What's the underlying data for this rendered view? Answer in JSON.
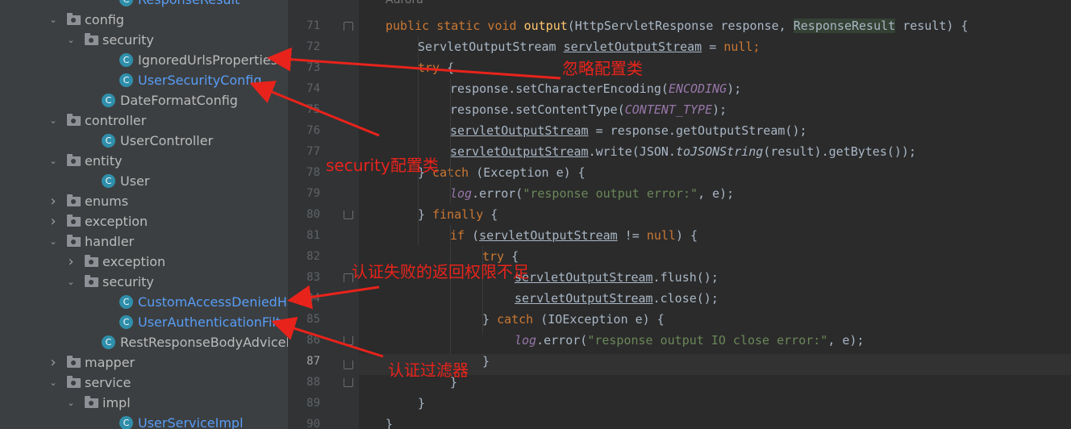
{
  "tree": {
    "items": [
      {
        "label": "ResponseResult",
        "kind": "class",
        "blue": true
      },
      {
        "label": "config",
        "kind": "folder",
        "expanded": true
      },
      {
        "label": "security",
        "kind": "folder",
        "expanded": true
      },
      {
        "label": "IgnoredUrlsProperties",
        "kind": "class",
        "blue": false
      },
      {
        "label": "UserSecurityConfig",
        "kind": "class",
        "blue": true
      },
      {
        "label": "DateFormatConfig",
        "kind": "class",
        "blue": false
      },
      {
        "label": "controller",
        "kind": "folder",
        "expanded": true
      },
      {
        "label": "UserController",
        "kind": "class",
        "blue": false
      },
      {
        "label": "entity",
        "kind": "folder",
        "expanded": true
      },
      {
        "label": "User",
        "kind": "class",
        "blue": false
      },
      {
        "label": "enums",
        "kind": "folder",
        "expanded": false
      },
      {
        "label": "exception",
        "kind": "folder",
        "expanded": false
      },
      {
        "label": "handler",
        "kind": "folder",
        "expanded": true
      },
      {
        "label": "exception",
        "kind": "folder",
        "expanded": false
      },
      {
        "label": "security",
        "kind": "folder",
        "expanded": true
      },
      {
        "label": "CustomAccessDeniedHandl",
        "kind": "class",
        "blue": true
      },
      {
        "label": "UserAuthenticationFilter",
        "kind": "class",
        "blue": true
      },
      {
        "label": "RestResponseBodyAdviceHand",
        "kind": "class",
        "blue": false
      },
      {
        "label": "mapper",
        "kind": "folder",
        "expanded": false
      },
      {
        "label": "service",
        "kind": "folder",
        "expanded": true
      },
      {
        "label": "impl",
        "kind": "folder",
        "expanded": true
      },
      {
        "label": "UserServiceImpl",
        "kind": "class",
        "blue": true
      }
    ]
  },
  "editor": {
    "author_hint": "Aurora",
    "line_numbers": [
      "71",
      "72",
      "73",
      "74",
      "75",
      "76",
      "77",
      "78",
      "79",
      "80",
      "81",
      "82",
      "83",
      "84",
      "85",
      "86",
      "87",
      "88",
      "89",
      "90"
    ],
    "current_line": "87",
    "code": {
      "l71": {
        "kw1": "public static void ",
        "fn": "output",
        "p1": "(HttpServletResponse response, ",
        "hl": "ResponseResult",
        "p2": " result) {"
      },
      "l72": {
        "a": "ServletOutputStream ",
        "b": "servletOutputStream",
        "c": " = ",
        "d": "null",
        "e": ";"
      },
      "l73": {
        "a": "try",
        "b": " {"
      },
      "l74": {
        "a": "response.setCharacterEncoding(",
        "b": "ENCODING",
        "c": ");"
      },
      "l75": {
        "a": "response.setContentType(",
        "b": "CONTENT_TYPE",
        "c": ");"
      },
      "l76": {
        "a": "servletOutputStream",
        "b": " = response.getOutputStream();"
      },
      "l77": {
        "a": "servletOutputStream",
        "b": ".write(JSON.",
        "c": "toJSONString",
        "d": "(result).getBytes());"
      },
      "l78": {
        "a": "} ",
        "b": "catch",
        "c": " (Exception e) {"
      },
      "l79": {
        "a": "log",
        "b": ".error(",
        "c": "\"response output error:\"",
        "d": ", e);"
      },
      "l80": {
        "a": "} ",
        "b": "finally",
        "c": " {"
      },
      "l81": {
        "a": "if",
        "b": " (",
        "c": "servletOutputStream",
        "d": " != ",
        "e": "null",
        "f": ") {"
      },
      "l82": {
        "a": "try",
        "b": " {"
      },
      "l83": {
        "a": "servletOutputStream",
        "b": ".flush();"
      },
      "l84": {
        "a": "servletOutputStream",
        "b": ".close();"
      },
      "l85": {
        "a": "} ",
        "b": "catch",
        "c": " (IOException e) {"
      },
      "l86": {
        "a": "log",
        "b": ".error(",
        "c": "\"response output IO close error:\"",
        "d": ", e);"
      },
      "l87": {
        "a": "}"
      },
      "l88": {
        "a": "}"
      },
      "l89": {
        "a": "}"
      },
      "l90": {
        "a": "}"
      }
    }
  },
  "annotations": {
    "ignore_config": "忽略配置类",
    "security_config": "security配置类",
    "auth_fail": "认证失败的返回权限不足",
    "auth_filter": "认证过滤器"
  },
  "colors": {
    "annotation": "#e8231b",
    "keyword": "#cc7832",
    "function": "#ffc66d",
    "string": "#6a8759",
    "constant": "#9876aa",
    "class_icon": "#2f8fab"
  }
}
